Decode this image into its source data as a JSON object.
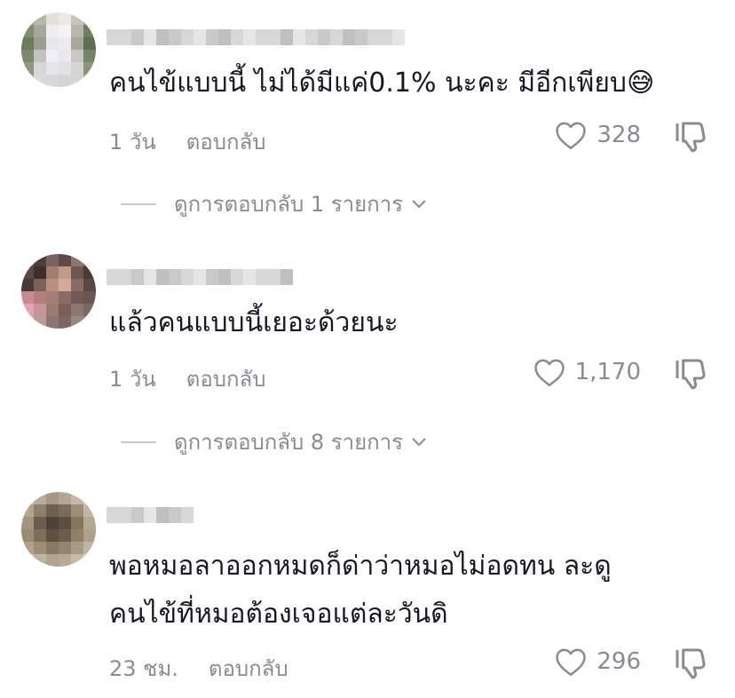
{
  "comments": [
    {
      "text_lines": [
        "คนไข้แบบนี้ ไม่ได้มีแค่0.1% นะคะ มีอีกเพียบ😅"
      ],
      "time": "1 วัน",
      "reply_label": "ตอบกลับ",
      "likes": "328",
      "replies_label": "ดูการตอบกลับ 1 รายการ"
    },
    {
      "text_lines": [
        "แล้วคนแบบนี้เยอะด้วยนะ"
      ],
      "time": "1 วัน",
      "reply_label": "ตอบกลับ",
      "likes": "1,170",
      "replies_label": "ดูการตอบกลับ 8 รายการ"
    },
    {
      "text_lines": [
        "พอหมอลาออกหมดก็ด่าว่าหมอไม่อดทน ละดู",
        "คนไข้ที่หมอต้องเจอแต่ละวันดิ"
      ],
      "time": "23 ชม.",
      "reply_label": "ตอบกลับ",
      "likes": "296"
    }
  ],
  "icons": {
    "like": "heart-outline-icon",
    "dislike": "thumbs-down-icon",
    "expand": "chevron-down-icon"
  },
  "colors": {
    "text": "#161823",
    "muted": "#8a8b91"
  }
}
